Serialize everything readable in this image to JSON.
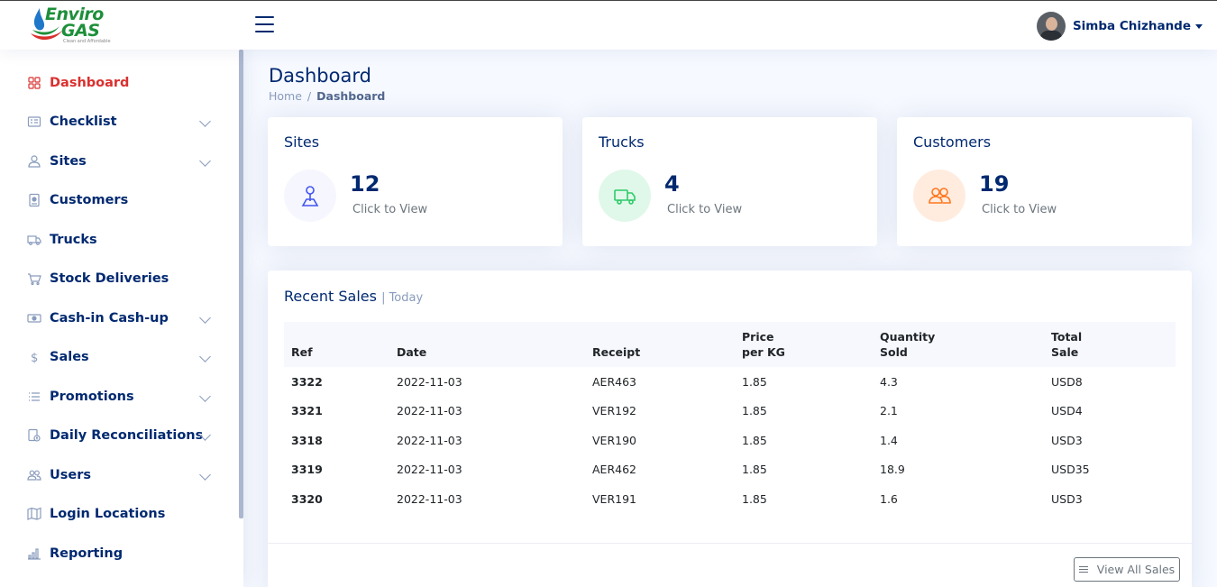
{
  "header": {
    "logo": {
      "line1": "Enviro",
      "line2": "GAS",
      "tagline": "Clean and Affordable"
    },
    "user_name": "Simba Chizhande"
  },
  "sidebar": {
    "items": [
      {
        "label": "Dashboard",
        "icon": "grid-icon",
        "active": true,
        "expandable": false
      },
      {
        "label": "Checklist",
        "icon": "checklist-icon",
        "expandable": true
      },
      {
        "label": "Sites",
        "icon": "person-pin-icon",
        "expandable": true
      },
      {
        "label": "Customers",
        "icon": "badge-icon",
        "expandable": false
      },
      {
        "label": "Trucks",
        "icon": "truck-icon",
        "expandable": false
      },
      {
        "label": "Stock Deliveries",
        "icon": "cart-icon",
        "expandable": false
      },
      {
        "label": "Cash-in Cash-up",
        "icon": "cash-icon",
        "expandable": true
      },
      {
        "label": "Sales",
        "icon": "dollar-icon",
        "expandable": true
      },
      {
        "label": "Promotions",
        "icon": "list-icon",
        "expandable": true
      },
      {
        "label": "Daily Reconciliations",
        "icon": "reconcile-icon",
        "expandable": true
      },
      {
        "label": "Users",
        "icon": "people-icon",
        "expandable": true
      },
      {
        "label": "Login Locations",
        "icon": "map-icon",
        "expandable": false
      },
      {
        "label": "Reporting",
        "icon": "bar-chart-icon",
        "expandable": false
      }
    ]
  },
  "page": {
    "title": "Dashboard",
    "breadcrumb": {
      "home": "Home",
      "separator": "/",
      "current": "Dashboard"
    }
  },
  "stats": [
    {
      "title": "Sites",
      "value": "12",
      "link": "Click to View",
      "icon": "person-pin-icon",
      "color": "#4154f1",
      "bg": "#f6f6fe"
    },
    {
      "title": "Trucks",
      "value": "4",
      "link": "Click to View",
      "icon": "truck-icon",
      "color": "#2eca6a",
      "bg": "#e0f8e9"
    },
    {
      "title": "Customers",
      "value": "19",
      "link": "Click to View",
      "icon": "people-icon",
      "color": "#ff771d",
      "bg": "#ffecdf"
    }
  ],
  "recent_sales": {
    "title": "Recent Sales",
    "subtitle": "| Today",
    "columns": [
      [
        "Ref"
      ],
      [
        "Date"
      ],
      [
        "Receipt"
      ],
      [
        "Price",
        "per KG"
      ],
      [
        "Quantity",
        "Sold"
      ],
      [
        "Total",
        "Sale"
      ]
    ],
    "rows": [
      [
        "3322",
        "2022-11-03",
        "AER463",
        "1.85",
        "4.3",
        "USD8"
      ],
      [
        "3321",
        "2022-11-03",
        "VER192",
        "1.85",
        "2.1",
        "USD4"
      ],
      [
        "3318",
        "2022-11-03",
        "VER190",
        "1.85",
        "1.4",
        "USD3"
      ],
      [
        "3319",
        "2022-11-03",
        "AER462",
        "1.85",
        "18.9",
        "USD35"
      ],
      [
        "3320",
        "2022-11-03",
        "VER191",
        "1.85",
        "1.6",
        "USD3"
      ]
    ],
    "view_all_label": "View All Sales"
  }
}
